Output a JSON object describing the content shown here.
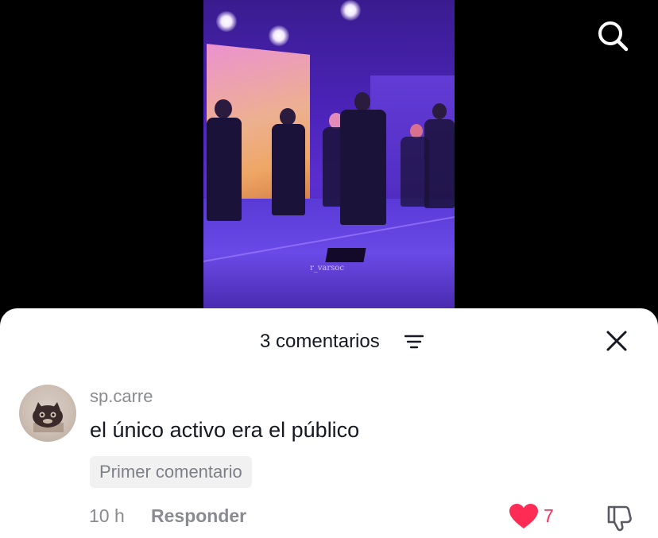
{
  "video": {
    "watermark": "r_varsoc",
    "search_icon": "search-icon"
  },
  "comments_sheet": {
    "title": "3 comentarios",
    "filter_icon": "filter-icon",
    "close_icon": "close-icon"
  },
  "comments": [
    {
      "username": "sp.carre",
      "text": "el único activo era el público",
      "badge": "Primer comentario",
      "time": "10 h",
      "reply_label": "Responder",
      "like_count": "7",
      "liked": true
    }
  ],
  "colors": {
    "like": "#fe2c55",
    "secondary_text": "#8a8b91",
    "primary_text": "#161823"
  }
}
